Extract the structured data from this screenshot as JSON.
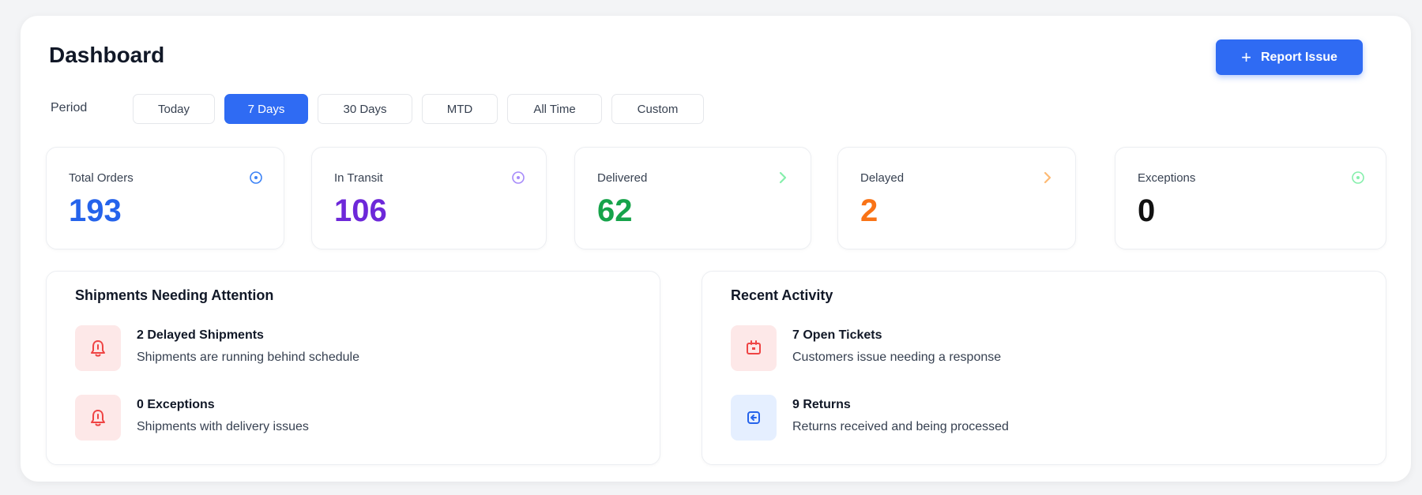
{
  "header": {
    "title": "Dashboard",
    "report_button": "Report Issue"
  },
  "period": {
    "label": "Period",
    "options": [
      "Today",
      "7 Days",
      "30 Days",
      "MTD",
      "All Time",
      "Custom"
    ],
    "selected": "7 Days"
  },
  "stats": [
    {
      "label": "Total Orders",
      "value": "193",
      "color": "#2563eb",
      "icon": "info-circle-icon"
    },
    {
      "label": "In Transit",
      "value": "106",
      "color": "#6d28d9",
      "icon": "info-circle-icon"
    },
    {
      "label": "Delivered",
      "value": "62",
      "color": "#16a34a",
      "icon": "chevron-right-icon"
    },
    {
      "label": "Delayed",
      "value": "2",
      "color": "#f97316",
      "icon": "chevron-right-icon"
    },
    {
      "label": "Exceptions",
      "value": "0",
      "color": "#111111",
      "icon": "check-circle-icon"
    }
  ],
  "attention": {
    "title": "Shipments Needing Attention",
    "items": [
      {
        "title": "2 Delayed Shipments",
        "subtitle": "Shipments are running behind schedule",
        "icon": "bell-icon"
      },
      {
        "title": "0 Exceptions",
        "subtitle": "Shipments with delivery issues",
        "icon": "bell-icon"
      }
    ]
  },
  "activity": {
    "title": "Recent Activity",
    "items": [
      {
        "title": "7 Open Tickets",
        "subtitle": "Customers issue needing a response",
        "icon": "ticket-icon"
      },
      {
        "title": "9 Returns",
        "subtitle": "Returns received and being processed",
        "icon": "return-icon"
      }
    ]
  },
  "colors": {
    "accent": "#2f6bf3",
    "alert_bg": "#fde8e8",
    "alert_icon": "#ef4444",
    "info_bg": "#e5efff"
  }
}
